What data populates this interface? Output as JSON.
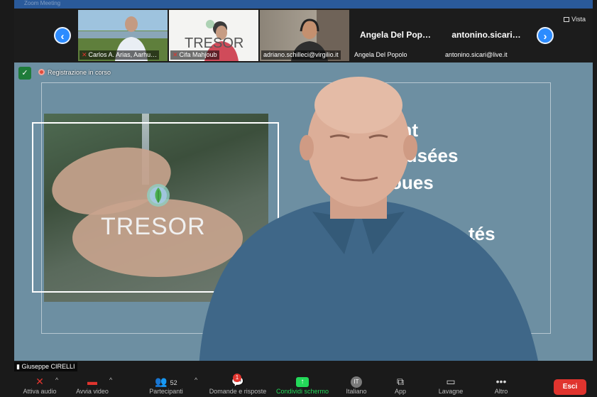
{
  "window": {
    "top_strip_title": "Zoom Meeting"
  },
  "gallery": {
    "tiles": [
      {
        "name": "Carlos A. Arias, Aarhu…",
        "muted": true
      },
      {
        "name": "Cifa Mahjoub",
        "muted": true
      },
      {
        "name": "adriano.schilleci@virgilio.it",
        "muted": false
      },
      {
        "big": "Angela Del Pop…",
        "name": "Angela Del Popolo",
        "muted": false
      },
      {
        "big": "antonino.sicari…",
        "name": "antonino.sicari@live.it",
        "muted": false
      }
    ],
    "nav_left": "‹",
    "nav_right": "›",
    "view_label": "Vista",
    "tile2_overlay": "TRESOR"
  },
  "main": {
    "recording": "Registrazione in corso",
    "security_icon": "shield-check-icon",
    "slide": {
      "logo": "TRESOR",
      "lines": [
        "ent",
        "x usées",
        "oues",
        "s",
        "tés",
        "e"
      ]
    }
  },
  "speaker": {
    "name": "Giuseppe CIRELLI"
  },
  "toolbar": {
    "audio": "Attiva audio",
    "video": "Avvia video",
    "participants": "Partecipanti",
    "participants_count": "52",
    "qa": "Domande e risposte",
    "qa_badge": "1",
    "share": "Condividi schermo",
    "language": "Italiano",
    "language_code": "IT",
    "apps": "App",
    "whiteboard": "Lavagne",
    "more": "Altro",
    "leave": "Esci"
  },
  "colors": {
    "accent": "#2d8cff",
    "share_green": "#23d959",
    "leave_red": "#e0342e",
    "slide_bg": "#6d8fa2"
  }
}
